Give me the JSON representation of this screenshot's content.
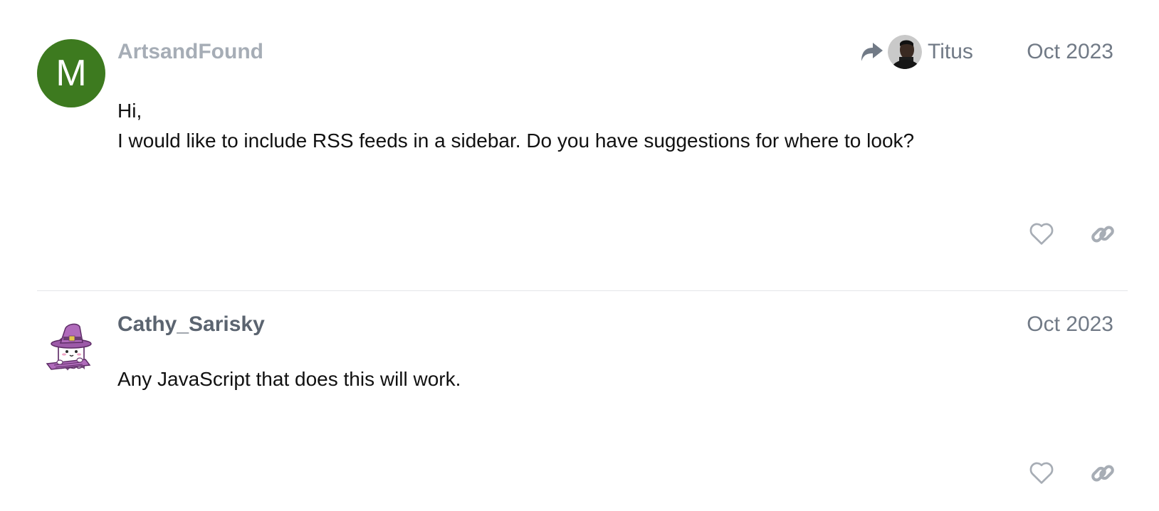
{
  "posts": [
    {
      "username": "ArtsandFound",
      "avatar_letter": "M",
      "avatar_color": "#3d7a1f",
      "reply_to": {
        "name": "Titus"
      },
      "date": "Oct 2023",
      "body": [
        "Hi,",
        "I would like to include RSS feeds in a sidebar. Do you have suggestions for where to look?"
      ]
    },
    {
      "username": "Cathy_Sarisky",
      "avatar_icon": "ghost-witch-avatar",
      "date": "Oct 2023",
      "body": [
        "Any JavaScript that does this will work."
      ]
    }
  ],
  "icons": {
    "reply": "reply-arrow-icon",
    "like": "heart-icon",
    "share": "link-icon"
  },
  "colors": {
    "muted": "#717a86",
    "icon": "#a7adb5",
    "divider": "#e4e6e9"
  }
}
